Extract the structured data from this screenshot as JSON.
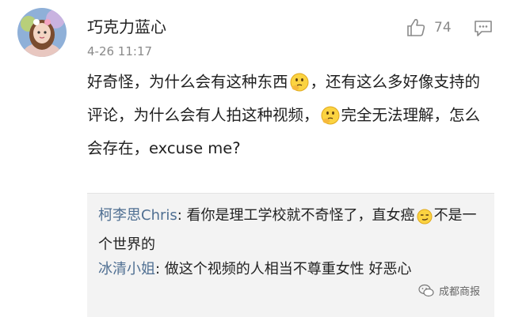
{
  "comment": {
    "username": "巧克力蓝心",
    "timestamp": "4-26 11:17",
    "like_count": "74",
    "body_parts": [
      "好奇怪，为什么会有这种东西",
      "，还有这么多好像支持的评论，为什么会有人拍这种视频，",
      "完全无法理解，怎么会存在，excuse me?"
    ]
  },
  "replies": [
    {
      "author": "柯李思Chris",
      "text_a": ": 看你是理工学校就不奇怪了，直女癌",
      "text_b": "不是一个世界的"
    },
    {
      "author": "冰清小姐",
      "text": ": 做这个视频的人相当不尊重女性 好恶心"
    }
  ],
  "watermark": {
    "text": "成都商报"
  },
  "icons": [
    "avatar",
    "thumbs-up-icon",
    "comment-icon",
    "thinking-emoji",
    "smirk-emoji",
    "wechat-icon"
  ],
  "colors": {
    "reply_author": "#4f6f92",
    "meta_gray": "#8a8a8a",
    "reply_bg": "#f3f3f3"
  }
}
